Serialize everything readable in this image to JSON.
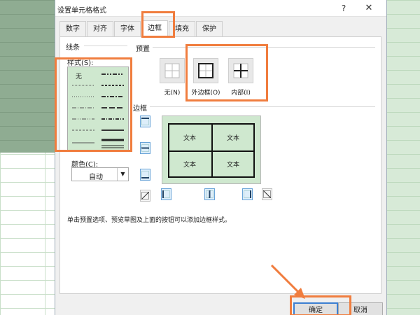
{
  "dialog": {
    "title": "设置单元格格式",
    "help": "?",
    "close": "✕"
  },
  "tabs": [
    {
      "label": "数字"
    },
    {
      "label": "对齐"
    },
    {
      "label": "字体"
    },
    {
      "label": "边框",
      "active": true
    },
    {
      "label": "填充"
    },
    {
      "label": "保护"
    }
  ],
  "line_group": {
    "title": "线条",
    "style_label": "样式(S):",
    "none_label": "无",
    "color_label": "颜色(C):",
    "color_value": "自动"
  },
  "preset_group": {
    "title": "预置",
    "buttons": [
      {
        "label": "无(N)",
        "icon": "border-none-icon"
      },
      {
        "label": "外边框(O)",
        "icon": "border-outline-icon"
      },
      {
        "label": "内部(I)",
        "icon": "border-inside-icon"
      }
    ]
  },
  "border_group": {
    "title": "边框",
    "preview_cells": [
      "文本",
      "文本",
      "文本",
      "文本"
    ]
  },
  "hint": "单击预置选项、预览草图及上面的按钮可以添加边框样式。",
  "buttons": {
    "ok": "确定",
    "cancel": "取消"
  },
  "colors": {
    "highlight": "#f07d3e",
    "preview_bg": "#cfe8cf",
    "ok_border": "#3c7fd1"
  }
}
